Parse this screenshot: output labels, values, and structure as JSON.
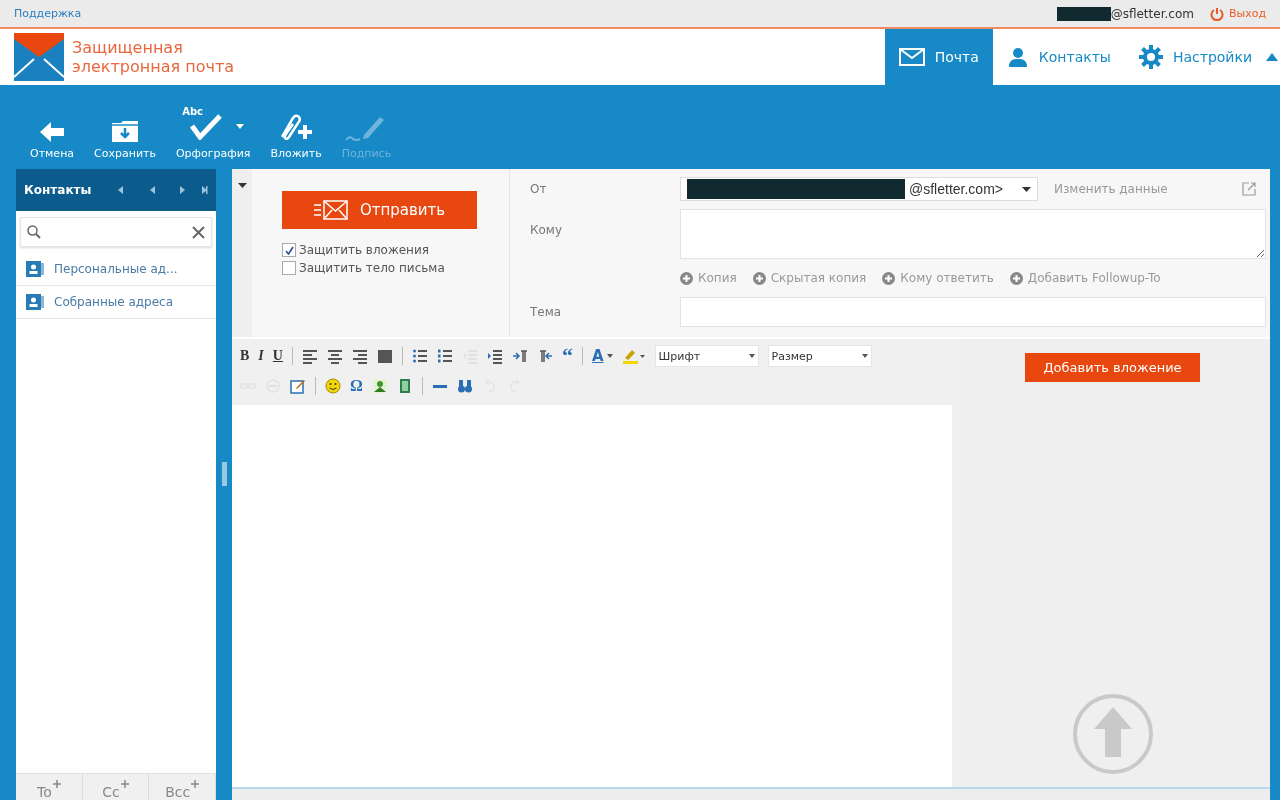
{
  "top_bar": {
    "support_link": "Поддержка",
    "user_email": "@sfletter.com",
    "logout": "Выход"
  },
  "logo": {
    "line1": "Защищенная",
    "line2": "электронная почта"
  },
  "nav_tabs": [
    {
      "label": "Почта",
      "kind": "mail",
      "selected": true
    },
    {
      "label": "Контакты",
      "kind": "contacts",
      "selected": false
    },
    {
      "label": "Настройки",
      "kind": "settings",
      "selected": false
    }
  ],
  "toolbar": [
    {
      "label": "Отмена",
      "kind": "back",
      "disabled": false
    },
    {
      "label": "Сохранить",
      "kind": "save",
      "disabled": false
    },
    {
      "label": "Орфография",
      "kind": "spell",
      "icon_text": "Abc",
      "disabled": false
    },
    {
      "label": "Вложить",
      "kind": "attach",
      "disabled": false
    },
    {
      "label": "Подпись",
      "kind": "sign",
      "disabled": true
    }
  ],
  "sidebar": {
    "title": "Контакты",
    "items": [
      {
        "label": "Персональные ад..."
      },
      {
        "label": "Собранные адреса"
      }
    ],
    "bottom_tabs": [
      {
        "label": "To"
      },
      {
        "label": "Cc"
      },
      {
        "label": "Bcc"
      }
    ]
  },
  "compose": {
    "send_button": "Отправить",
    "options": [
      {
        "label": "Защитить вложения",
        "checked": true
      },
      {
        "label": "Защитить тело письма",
        "checked": false
      }
    ],
    "from_label": "От",
    "from_value": "@sfletter.com>",
    "edit_identity": "Изменить данные",
    "to_label": "Кому",
    "subject_label": "Тема",
    "add_links": [
      {
        "label": "Копия"
      },
      {
        "label": "Скрытая копия"
      },
      {
        "label": "Кому ответить"
      },
      {
        "label": "Добавить Followup-To"
      }
    ]
  },
  "editor_toolbar": [
    {
      "kind": "bold",
      "label": "B",
      "disabled": false
    },
    {
      "kind": "italic",
      "label": "I",
      "disabled": false
    },
    {
      "kind": "underline",
      "label": "U",
      "disabled": false
    },
    {
      "kind": "sep"
    },
    {
      "kind": "align-left",
      "disabled": false
    },
    {
      "kind": "align-center",
      "disabled": false
    },
    {
      "kind": "align-right",
      "disabled": false
    },
    {
      "kind": "justify",
      "disabled": false
    },
    {
      "kind": "sep"
    },
    {
      "kind": "bullets",
      "disabled": false
    },
    {
      "kind": "numbers",
      "disabled": false
    },
    {
      "kind": "outdent",
      "disabled": true
    },
    {
      "kind": "indent",
      "disabled": false
    },
    {
      "kind": "ltr",
      "disabled": false
    },
    {
      "kind": "rtl",
      "disabled": false
    },
    {
      "kind": "quote",
      "label": "“",
      "disabled": false
    },
    {
      "kind": "sep"
    },
    {
      "kind": "text-color",
      "label": "A",
      "disabled": false
    },
    {
      "kind": "highlight",
      "disabled": false
    },
    {
      "kind": "select",
      "label": "Шрифт"
    },
    {
      "kind": "select",
      "label": "Размер"
    },
    {
      "kind": "break"
    },
    {
      "kind": "link",
      "disabled": true
    },
    {
      "kind": "unlink",
      "disabled": true
    },
    {
      "kind": "edit",
      "disabled": false
    },
    {
      "kind": "sep"
    },
    {
      "kind": "smiley",
      "disabled": false
    },
    {
      "kind": "omega",
      "label": "Ω",
      "disabled": false
    },
    {
      "kind": "image",
      "disabled": false
    },
    {
      "kind": "media",
      "disabled": false
    },
    {
      "kind": "sep"
    },
    {
      "kind": "hr",
      "disabled": false
    },
    {
      "kind": "find",
      "disabled": false
    },
    {
      "kind": "undo",
      "disabled": true
    },
    {
      "kind": "redo",
      "disabled": true
    }
  ],
  "attachments": {
    "button": "Добавить вложение"
  }
}
